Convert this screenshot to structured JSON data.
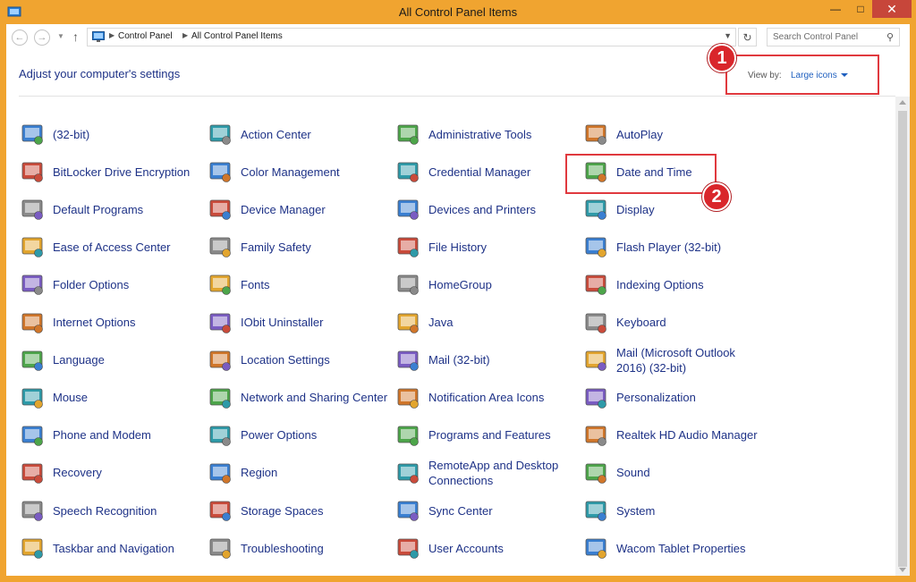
{
  "window": {
    "title": "All Control Panel Items"
  },
  "navbar": {
    "breadcrumbs": [
      "Control Panel",
      "All Control Panel Items"
    ],
    "search_placeholder": "Search Control Panel"
  },
  "header": {
    "title": "Adjust your computer's settings",
    "view_by_label": "View by:",
    "view_by_value": "Large icons"
  },
  "annotations": {
    "marker1": "1",
    "marker2": "2"
  },
  "items": [
    {
      "label": "(32-bit)",
      "icon": "program-32bit-icon"
    },
    {
      "label": "BitLocker Drive Encryption",
      "icon": "bitlocker-icon"
    },
    {
      "label": "Default Programs",
      "icon": "default-programs-icon"
    },
    {
      "label": "Ease of Access Center",
      "icon": "ease-of-access-icon"
    },
    {
      "label": "Folder Options",
      "icon": "folder-options-icon"
    },
    {
      "label": "Internet Options",
      "icon": "internet-options-icon"
    },
    {
      "label": "Language",
      "icon": "language-icon"
    },
    {
      "label": "Mouse",
      "icon": "mouse-icon"
    },
    {
      "label": "Phone and Modem",
      "icon": "phone-modem-icon"
    },
    {
      "label": "Recovery",
      "icon": "recovery-icon"
    },
    {
      "label": "Speech Recognition",
      "icon": "microphone-icon"
    },
    {
      "label": "Taskbar and Navigation",
      "icon": "taskbar-icon"
    },
    {
      "label": "Action Center",
      "icon": "flag-icon"
    },
    {
      "label": "Color Management",
      "icon": "color-management-icon"
    },
    {
      "label": "Device Manager",
      "icon": "device-manager-icon"
    },
    {
      "label": "Family Safety",
      "icon": "family-safety-icon"
    },
    {
      "label": "Fonts",
      "icon": "fonts-icon"
    },
    {
      "label": "IObit Uninstaller",
      "icon": "iobit-uninstaller-icon"
    },
    {
      "label": "Location Settings",
      "icon": "location-icon"
    },
    {
      "label": "Network and Sharing Center",
      "icon": "network-icon"
    },
    {
      "label": "Power Options",
      "icon": "power-options-icon"
    },
    {
      "label": "Region",
      "icon": "region-icon"
    },
    {
      "label": "Storage Spaces",
      "icon": "storage-spaces-icon"
    },
    {
      "label": "Troubleshooting",
      "icon": "troubleshooting-icon"
    },
    {
      "label": "Administrative Tools",
      "icon": "admin-tools-icon"
    },
    {
      "label": "Credential Manager",
      "icon": "credential-manager-icon"
    },
    {
      "label": "Devices and Printers",
      "icon": "printer-icon"
    },
    {
      "label": "File History",
      "icon": "file-history-icon"
    },
    {
      "label": "HomeGroup",
      "icon": "homegroup-icon"
    },
    {
      "label": "Java",
      "icon": "java-icon"
    },
    {
      "label": "Mail (32-bit)",
      "icon": "mail-icon"
    },
    {
      "label": "Notification Area Icons",
      "icon": "notification-area-icon"
    },
    {
      "label": "Programs and Features",
      "icon": "programs-features-icon"
    },
    {
      "label": "RemoteApp and Desktop Connections",
      "icon": "remoteapp-icon"
    },
    {
      "label": "Sync Center",
      "icon": "sync-center-icon"
    },
    {
      "label": "User Accounts",
      "icon": "user-accounts-icon"
    },
    {
      "label": "AutoPlay",
      "icon": "autoplay-icon"
    },
    {
      "label": "Date and Time",
      "icon": "calendar-clock-icon"
    },
    {
      "label": "Display",
      "icon": "display-icon"
    },
    {
      "label": "Flash Player (32-bit)",
      "icon": "flash-player-icon"
    },
    {
      "label": "Indexing Options",
      "icon": "indexing-options-icon"
    },
    {
      "label": "Keyboard",
      "icon": "keyboard-icon"
    },
    {
      "label": "Mail (Microsoft Outlook 2016) (32-bit)",
      "icon": "outlook-mail-icon"
    },
    {
      "label": "Personalization",
      "icon": "personalization-icon"
    },
    {
      "label": "Realtek HD Audio Manager",
      "icon": "realtek-audio-icon"
    },
    {
      "label": "Sound",
      "icon": "speaker-icon"
    },
    {
      "label": "System",
      "icon": "system-icon"
    },
    {
      "label": "Wacom Tablet Properties",
      "icon": "wacom-tablet-icon"
    }
  ],
  "colors": {
    "titlebar": "#f0a430",
    "link": "#1e3287",
    "highlight": "#e0393e",
    "marker": "#d9262b"
  }
}
